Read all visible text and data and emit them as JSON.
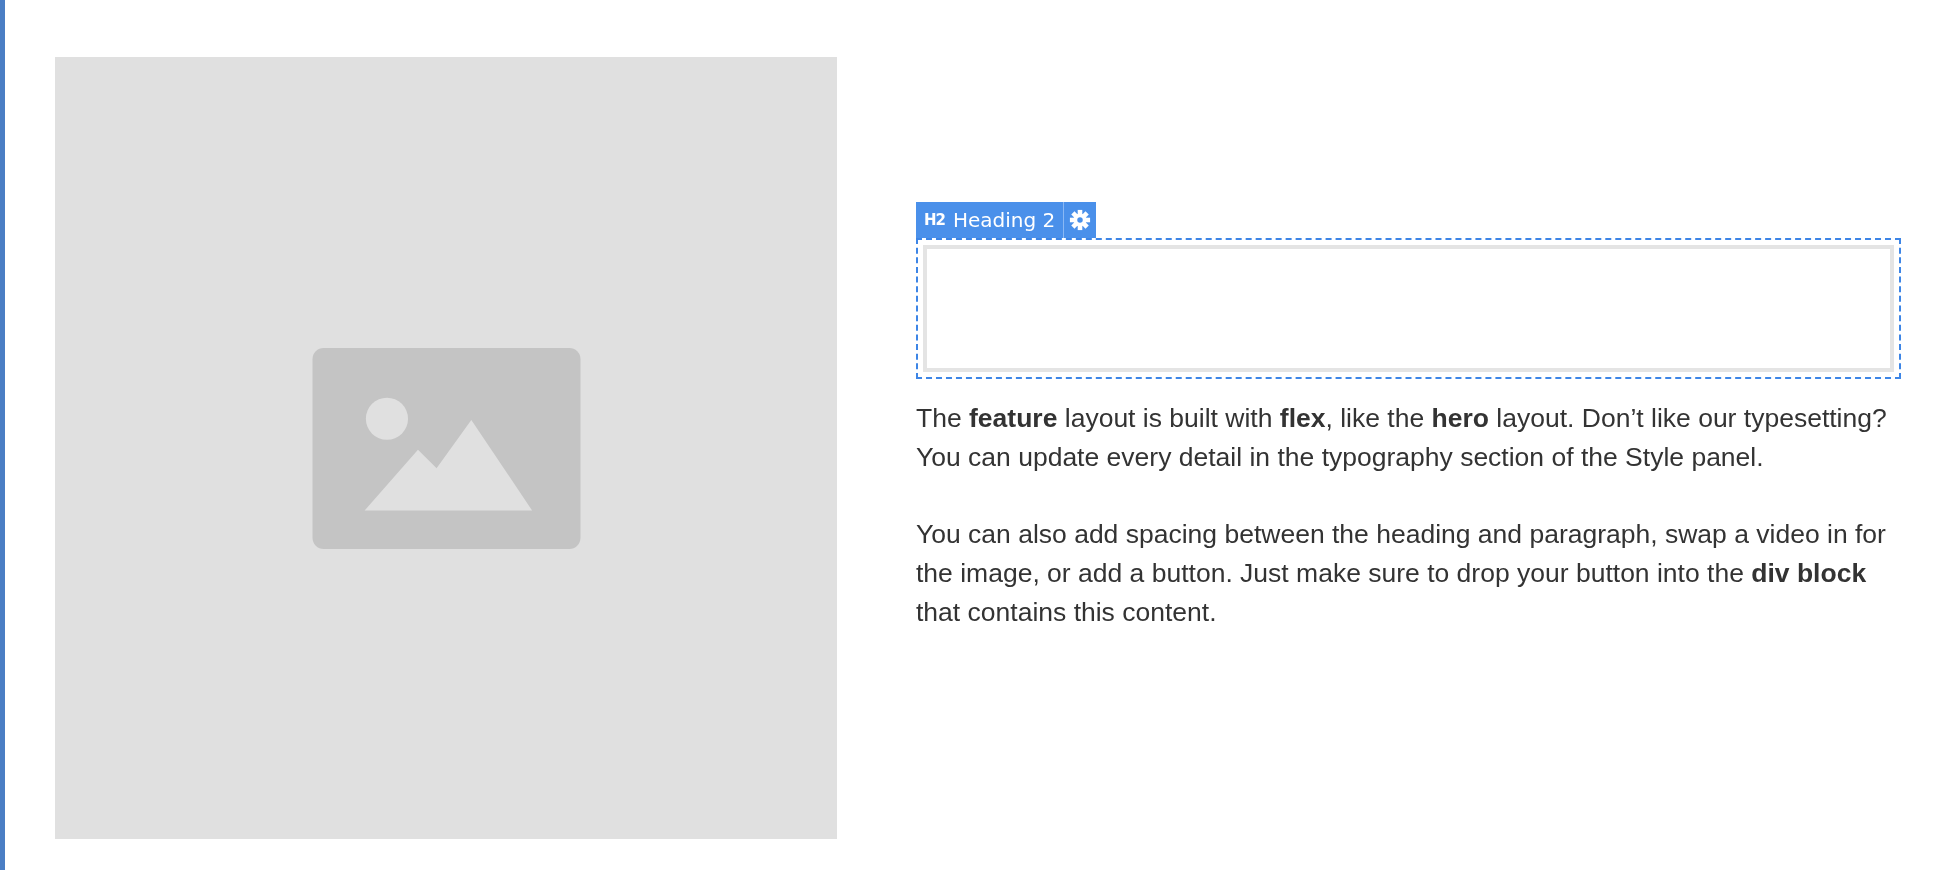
{
  "heading_element": {
    "tag": "H2",
    "label": "Heading 2",
    "selected": true
  },
  "paragraphs": [
    "The **feature** layout is built with **flex**, like the **hero** layout. Don’t like our typesetting? You can update every detail in the typography section of the Style panel.",
    "You can also add spacing between the heading and paragraph, swap a video in for the image, or add a button. Just make sure to drop your button into the **div block** that contains this content."
  ]
}
